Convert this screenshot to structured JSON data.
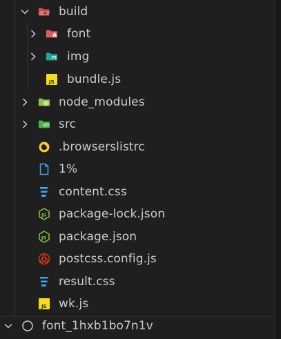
{
  "explorer": {
    "items": [
      {
        "label": "build",
        "icon": "folder-build-open-icon",
        "chevron": "chevron-down",
        "depth": 1
      },
      {
        "label": "font",
        "icon": "folder-font-icon",
        "chevron": "chevron-right",
        "depth": 2
      },
      {
        "label": "img",
        "icon": "folder-images-icon",
        "chevron": "chevron-right",
        "depth": 2
      },
      {
        "label": "bundle.js",
        "icon": "javascript-file-icon",
        "chevron": "",
        "depth": 2
      },
      {
        "label": "node_modules",
        "icon": "folder-node-icon",
        "chevron": "chevron-right",
        "depth": 1
      },
      {
        "label": "src",
        "icon": "folder-src-icon",
        "chevron": "chevron-right",
        "depth": 1
      },
      {
        "label": ".browserslistrc",
        "icon": "browserslist-icon",
        "chevron": "",
        "depth": 1
      },
      {
        "label": "1%",
        "icon": "file-icon",
        "chevron": "",
        "depth": 1
      },
      {
        "label": "content.css",
        "icon": "css-file-icon",
        "chevron": "",
        "depth": 1
      },
      {
        "label": "package-lock.json",
        "icon": "nodejs-icon",
        "chevron": "",
        "depth": 1
      },
      {
        "label": "package.json",
        "icon": "nodejs-icon",
        "chevron": "",
        "depth": 1
      },
      {
        "label": "postcss.config.js",
        "icon": "postcss-icon",
        "chevron": "",
        "depth": 1
      },
      {
        "label": "result.css",
        "icon": "css-file-icon",
        "chevron": "",
        "depth": 1
      },
      {
        "label": "wk.js",
        "icon": "javascript-file-icon",
        "chevron": "",
        "depth": 1
      }
    ],
    "section": {
      "label": "font_1hxb1bo7n1v",
      "icon": "circle-icon",
      "chevron": "chevron-down"
    }
  },
  "colors": {
    "background": "#1f1f1f",
    "text": "#cccccc",
    "folder_red": "#e35d5d",
    "folder_teal": "#26a69a",
    "folder_green": "#8bc34a",
    "js_yellow": "#f5de19",
    "css_blue": "#42a5f5",
    "node_green": "#8bc34a",
    "postcss_red": "#dd3a0a",
    "browserslist_yellow": "#ffca28",
    "file_blue": "#42a5f5"
  }
}
